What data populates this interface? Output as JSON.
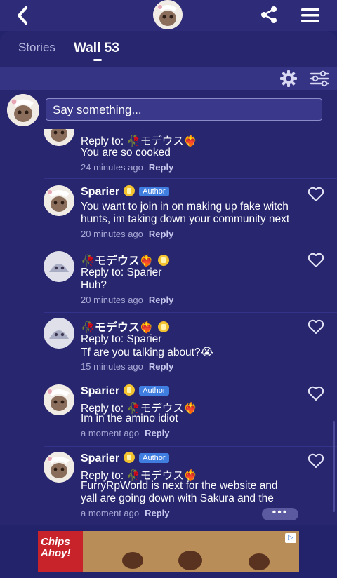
{
  "header": {
    "icons": [
      "back-icon",
      "share-icon",
      "menu-icon"
    ]
  },
  "tabs": [
    {
      "label": "Stories"
    },
    {
      "label": "Wall 53"
    }
  ],
  "compose": {
    "placeholder": "Say something..."
  },
  "comments": [
    {
      "reply_to": "Reply to: 🥀モデウス❤️‍🔥",
      "text": [
        "You are so cooked"
      ],
      "time": "24 minutes ago",
      "reply_label": "Reply"
    },
    {
      "author": "Sparier",
      "author_badge": "Author",
      "text": [
        "You want to join in on making up fake witch",
        "hunts, im taking down your community next"
      ],
      "time": "20 minutes ago",
      "reply_label": "Reply"
    },
    {
      "author": "🥀モデウス❤️‍🔥",
      "reply_to": "Reply to: Sparier",
      "text": [
        "Huh?"
      ],
      "time": "20 minutes ago",
      "reply_label": "Reply"
    },
    {
      "author": "🥀モデウス❤️‍🔥",
      "reply_to": "Reply to: Sparier",
      "text": [
        "Tf are you talking about?😭"
      ],
      "time": "15 minutes ago",
      "reply_label": "Reply"
    },
    {
      "author": "Sparier",
      "author_badge": "Author",
      "reply_to": "Reply to: 🥀モデウス❤️‍🔥",
      "text": [
        "Im in the amino idiot"
      ],
      "time": "a moment ago",
      "reply_label": "Reply"
    },
    {
      "author": "Sparier",
      "author_badge": "Author",
      "reply_to": "Reply to: 🥀モデウス❤️‍🔥",
      "text": [
        "FurryRpWorld is next for the website and",
        "yall are going down with Sakura and the"
      ],
      "time": "a moment ago",
      "reply_label": "Reply"
    }
  ],
  "ad": {
    "brand": "Chips Ahoy!"
  },
  "colors": {
    "background": "#23236b",
    "author_badge": "#3f7de0",
    "gold_badge": "#f3c22f"
  }
}
